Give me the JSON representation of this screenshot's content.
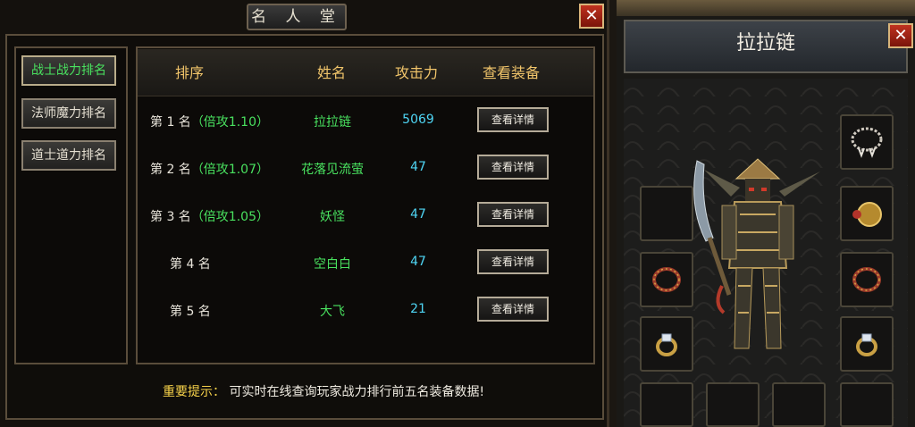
{
  "left_window": {
    "title": "名 人 堂",
    "close_glyph": "✕"
  },
  "sidebar": {
    "items": [
      {
        "label": "战士战力排名",
        "active": true
      },
      {
        "label": "法师魔力排名",
        "active": false
      },
      {
        "label": "道士道力排名",
        "active": false
      }
    ]
  },
  "table": {
    "headers": [
      "排序",
      "姓名",
      "攻击力",
      "查看装备"
    ],
    "rows": [
      {
        "rank": "第 1 名",
        "multiplier": "（倍攻1.10）",
        "name": "拉拉链",
        "attack": "5069",
        "button": "查看详情"
      },
      {
        "rank": "第 2 名",
        "multiplier": "（倍攻1.07）",
        "name": "花落见流萤",
        "attack": "47",
        "button": "查看详情"
      },
      {
        "rank": "第 3 名",
        "multiplier": "（倍攻1.05）",
        "name": "妖怪",
        "attack": "47",
        "button": "查看详情"
      },
      {
        "rank": "第 4 名",
        "multiplier": "",
        "name": "空白白",
        "attack": "47",
        "button": "查看详情"
      },
      {
        "rank": "第 5 名",
        "multiplier": "",
        "name": "大飞",
        "attack": "21",
        "button": "查看详情"
      }
    ]
  },
  "tip": {
    "label": "重要提示：",
    "text": "可实时在线查询玩家战力排行前五名装备数据!"
  },
  "character": {
    "name": "拉拉链",
    "close_glyph": "✕"
  },
  "colors": {
    "accent_green": "#49e15f",
    "attack_cyan": "#4fd6f5",
    "header_gold": "#f0c46a",
    "close_red": "#b0281a"
  }
}
